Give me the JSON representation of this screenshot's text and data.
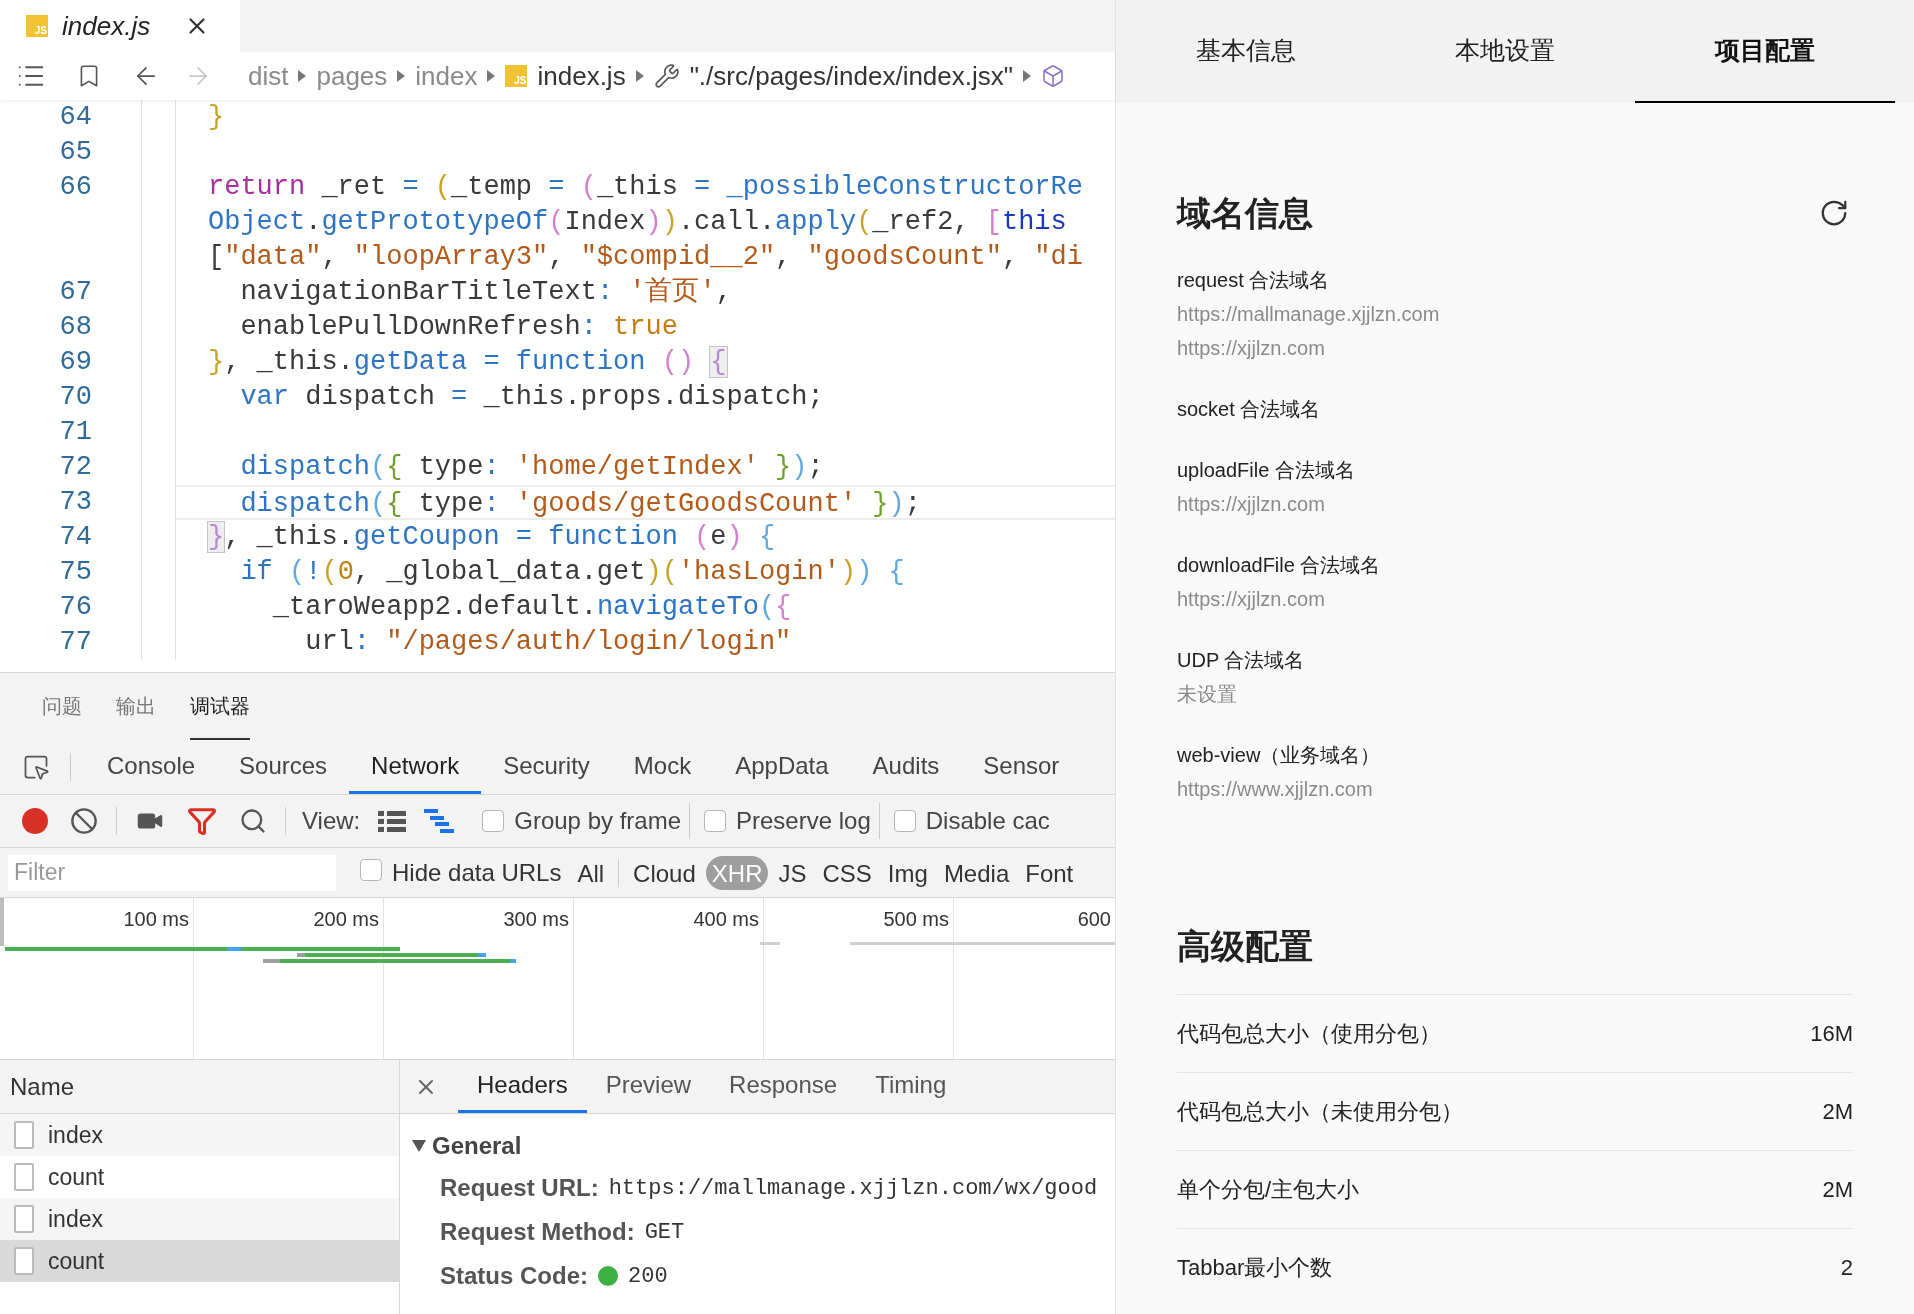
{
  "editor": {
    "tab": {
      "badge": "JS",
      "title": "index.js"
    },
    "breadcrumbs": [
      {
        "label": "dist",
        "kind": "folder"
      },
      {
        "label": "pages",
        "kind": "folder"
      },
      {
        "label": "index",
        "kind": "folder"
      },
      {
        "label": "index.js",
        "kind": "file",
        "badge": "JS"
      },
      {
        "label": "\"./src/pages/index/index.jsx\"",
        "kind": "symbol"
      }
    ],
    "code_lines": [
      {
        "number": "64",
        "current": false,
        "tokens": [
          {
            "text": "}",
            "kind": "p1"
          }
        ]
      },
      {
        "number": "65",
        "current": false
      },
      {
        "number": "66",
        "current": false,
        "tokens": [
          {
            "text": "return",
            "kind": "k"
          },
          {
            "text": " _ret ",
            "kind": "t"
          },
          {
            "text": "= ",
            "kind": "b"
          },
          {
            "text": "(",
            "kind": "p1"
          },
          {
            "text": "_temp ",
            "kind": "t"
          },
          {
            "text": "= ",
            "kind": "b"
          },
          {
            "text": "(",
            "kind": "p2"
          },
          {
            "text": "_this ",
            "kind": "t"
          },
          {
            "text": "=",
            "kind": "b"
          },
          {
            "text": " _possibleConstructorRe",
            "kind": "b"
          }
        ]
      },
      {
        "current": false,
        "tokens": [
          {
            "text": "Object",
            "kind": "b"
          },
          {
            "text": ".",
            "kind": "t"
          },
          {
            "text": "getPrototypeOf",
            "kind": "b"
          },
          {
            "text": "(",
            "kind": "p2"
          },
          {
            "text": "Index",
            "kind": "t"
          },
          {
            "text": ")",
            "kind": "p2"
          },
          {
            "text": ")",
            "kind": "p1"
          },
          {
            "text": ".call.",
            "kind": "t"
          },
          {
            "text": "apply",
            "kind": "b"
          },
          {
            "text": "(",
            "kind": "p1"
          },
          {
            "text": "_ref2, ",
            "kind": "t"
          },
          {
            "text": "[",
            "kind": "p2"
          },
          {
            "text": "this",
            "kind": "th"
          }
        ]
      },
      {
        "current": false,
        "tokens": [
          {
            "text": "[",
            "kind": "t"
          },
          {
            "text": "\"data\"",
            "kind": "s"
          },
          {
            "text": ", ",
            "kind": "t"
          },
          {
            "text": "\"loopArray3\"",
            "kind": "s"
          },
          {
            "text": ", ",
            "kind": "t"
          },
          {
            "text": "\"$compid__2\"",
            "kind": "s"
          },
          {
            "text": ", ",
            "kind": "t"
          },
          {
            "text": "\"goodsCount\"",
            "kind": "s"
          },
          {
            "text": ", ",
            "kind": "t"
          },
          {
            "text": "\"di",
            "kind": "s"
          }
        ]
      },
      {
        "number": "67",
        "current": false,
        "tokens": [
          {
            "text": "  navigationBarTitleText",
            "kind": "t"
          },
          {
            "text": ": ",
            "kind": "b"
          },
          {
            "text": "'首页'",
            "kind": "s"
          },
          {
            "text": ",",
            "kind": "t"
          }
        ]
      },
      {
        "number": "68",
        "current": false,
        "tokens": [
          {
            "text": "  enablePullDownRefresh",
            "kind": "t"
          },
          {
            "text": ": ",
            "kind": "b"
          },
          {
            "text": "true",
            "kind": "l"
          }
        ]
      },
      {
        "number": "69",
        "current": false,
        "tokens": [
          {
            "text": "}",
            "kind": "p1"
          },
          {
            "text": ", _this.",
            "kind": "t"
          },
          {
            "text": "getData",
            "kind": "b"
          },
          {
            "text": " = ",
            "kind": "b"
          },
          {
            "text": "function ",
            "kind": "b"
          },
          {
            "text": "() ",
            "kind": "p2"
          },
          {
            "text": "{",
            "kind": "m"
          }
        ]
      },
      {
        "number": "70",
        "current": false,
        "tokens": [
          {
            "text": "  var",
            "kind": "b"
          },
          {
            "text": " dispatch ",
            "kind": "t"
          },
          {
            "text": "=",
            "kind": "b"
          },
          {
            "text": " _this.props.dispatch;",
            "kind": "t"
          }
        ]
      },
      {
        "number": "71",
        "current": false
      },
      {
        "number": "72",
        "current": false,
        "tokens": [
          {
            "text": "  dispatch",
            "kind": "b"
          },
          {
            "text": "(",
            "kind": "p3"
          },
          {
            "text": "{",
            "kind": "g"
          },
          {
            "text": " type",
            "kind": "t"
          },
          {
            "text": ": ",
            "kind": "b"
          },
          {
            "text": "'home/getIndex' ",
            "kind": "s"
          },
          {
            "text": "}",
            "kind": "g"
          },
          {
            "text": ")",
            "kind": "p3"
          },
          {
            "text": ";",
            "kind": "t"
          }
        ]
      },
      {
        "number": "73",
        "current": true,
        "tokens": [
          {
            "text": "  dispatch",
            "kind": "b"
          },
          {
            "text": "(",
            "kind": "p3"
          },
          {
            "text": "{",
            "kind": "g"
          },
          {
            "text": " type",
            "kind": "t"
          },
          {
            "text": ": ",
            "kind": "b"
          },
          {
            "text": "'goods/getGoodsCount' ",
            "kind": "s"
          },
          {
            "text": "}",
            "kind": "g"
          },
          {
            "text": ")",
            "kind": "p3"
          },
          {
            "text": ";",
            "kind": "t"
          }
        ]
      },
      {
        "number": "74",
        "current": false,
        "tokens": [
          {
            "text": "}",
            "kind": "m"
          },
          {
            "text": ", _this.",
            "kind": "t"
          },
          {
            "text": "getCoupon",
            "kind": "b"
          },
          {
            "text": " = ",
            "kind": "b"
          },
          {
            "text": "function ",
            "kind": "b"
          },
          {
            "text": "(",
            "kind": "p2"
          },
          {
            "text": "e",
            "kind": "t"
          },
          {
            "text": ") ",
            "kind": "p2"
          },
          {
            "text": "{",
            "kind": "p3"
          }
        ]
      },
      {
        "number": "75",
        "current": false,
        "tokens": [
          {
            "text": "  if ",
            "kind": "b"
          },
          {
            "text": "(",
            "kind": "p3"
          },
          {
            "text": "!",
            "kind": "b"
          },
          {
            "text": "(",
            "kind": "p1"
          },
          {
            "text": "0",
            "kind": "l"
          },
          {
            "text": ", _global_data.get",
            "kind": "t"
          },
          {
            "text": ")",
            "kind": "p1"
          },
          {
            "text": "(",
            "kind": "p1"
          },
          {
            "text": "'hasLogin'",
            "kind": "s"
          },
          {
            "text": ")",
            "kind": "p1"
          },
          {
            "text": ") ",
            "kind": "p3"
          },
          {
            "text": "{",
            "kind": "p3"
          }
        ]
      },
      {
        "number": "76",
        "current": false,
        "tokens": [
          {
            "text": "    _taroWeapp2.default.",
            "kind": "t"
          },
          {
            "text": "navigateTo",
            "kind": "b"
          },
          {
            "text": "(",
            "kind": "p3"
          },
          {
            "text": "{",
            "kind": "p2"
          }
        ]
      },
      {
        "number": "77",
        "current": false,
        "tokens": [
          {
            "text": "      url",
            "kind": "t"
          },
          {
            "text": ": ",
            "kind": "b"
          },
          {
            "text": "\"/pages/auth/login/login\"",
            "kind": "s"
          }
        ]
      }
    ]
  },
  "panel_tabs": [
    {
      "label": "问题",
      "selected": false
    },
    {
      "label": "输出",
      "selected": false
    },
    {
      "label": "调试器",
      "selected": true
    }
  ],
  "devtools": {
    "tabs": [
      {
        "label": "Console",
        "selected": false
      },
      {
        "label": "Sources",
        "selected": false
      },
      {
        "label": "Network",
        "selected": true
      },
      {
        "label": "Security",
        "selected": false
      },
      {
        "label": "Mock",
        "selected": false
      },
      {
        "label": "AppData",
        "selected": false
      },
      {
        "label": "Audits",
        "selected": false
      },
      {
        "label": "Sensor",
        "selected": false
      }
    ],
    "toolbar": {
      "recording": true,
      "view_label": "View:",
      "view_modes": [
        {
          "kind": "list",
          "selected": false
        },
        {
          "kind": "waterfall",
          "selected": true
        }
      ],
      "options": [
        {
          "label": "Group by frame",
          "checked": false
        },
        {
          "label": "Preserve log",
          "checked": false
        },
        {
          "label": "Disable cac",
          "checked": false
        }
      ]
    },
    "filter": {
      "placeholder": "Filter",
      "hide_data_urls": {
        "label": "Hide data URLs",
        "checked": false
      },
      "types": [
        {
          "label": "All",
          "selected": false
        },
        {
          "label": "Cloud",
          "selected": false
        },
        {
          "label": "XHR",
          "selected": true
        },
        {
          "label": "JS",
          "selected": false
        },
        {
          "label": "CSS",
          "selected": false
        },
        {
          "label": "Img",
          "selected": false
        },
        {
          "label": "Media",
          "selected": false
        },
        {
          "label": "Font",
          "selected": false
        }
      ]
    },
    "timeline": {
      "ticks": [
        "100 ms",
        "200 ms",
        "300 ms",
        "400 ms",
        "500 ms",
        "600"
      ]
    },
    "requests": {
      "header": "Name",
      "rows": [
        {
          "name": "index",
          "selected": false
        },
        {
          "name": "count",
          "selected": false
        },
        {
          "name": "index",
          "selected": false
        },
        {
          "name": "count",
          "selected": true
        }
      ]
    },
    "details": {
      "tabs": [
        {
          "label": "Headers",
          "selected": true
        },
        {
          "label": "Preview",
          "selected": false
        },
        {
          "label": "Response",
          "selected": false
        },
        {
          "label": "Timing",
          "selected": false
        }
      ],
      "section": {
        "title": "General",
        "expanded": true,
        "fields": [
          {
            "label": "Request URL:",
            "value": "https://mallmanage.xjjlzn.com/wx/good",
            "kind": "text"
          },
          {
            "label": "Request Method:",
            "value": "GET",
            "kind": "text"
          },
          {
            "label": "Status Code:",
            "value": "200",
            "kind": "status"
          }
        ]
      }
    }
  },
  "project": {
    "tabs": [
      {
        "label": "基本信息",
        "selected": false
      },
      {
        "label": "本地设置",
        "selected": false
      },
      {
        "label": "项目配置",
        "selected": true
      }
    ],
    "domains": {
      "title": "域名信息",
      "entries": [
        {
          "label": "request 合法域名",
          "values": [
            "https://mallmanage.xjjlzn.com",
            "https://xjjlzn.com"
          ]
        },
        {
          "label": "socket 合法域名"
        },
        {
          "label": "uploadFile 合法域名",
          "values": [
            "https://xjjlzn.com"
          ]
        },
        {
          "label": "downloadFile 合法域名",
          "values": [
            "https://xjjlzn.com"
          ]
        },
        {
          "label": "UDP 合法域名",
          "values": [
            "未设置"
          ]
        },
        {
          "label": "web-view（业务域名）",
          "values": [
            "https://www.xjjlzn.com"
          ]
        }
      ]
    },
    "advanced": {
      "title": "高级配置",
      "rows": [
        {
          "label": "代码包总大小（使用分包）",
          "value": "16M"
        },
        {
          "label": "代码包总大小（未使用分包）",
          "value": "2M"
        },
        {
          "label": "单个分包/主包大小",
          "value": "2M"
        },
        {
          "label": "Tabbar最小个数",
          "value": "2"
        }
      ]
    }
  }
}
